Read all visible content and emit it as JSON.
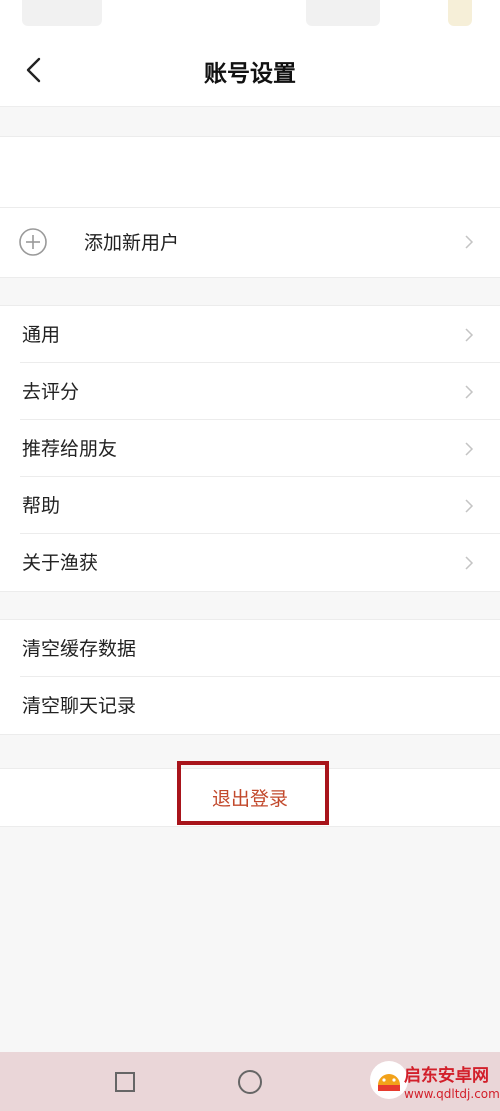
{
  "header": {
    "title": "账号设置",
    "back_icon": "chevron-left-icon"
  },
  "profile_section": {
    "add_user_label": "添加新用户",
    "add_user_icon": "plus-circle-icon"
  },
  "general_section": {
    "items": [
      {
        "label": "通用"
      },
      {
        "label": "去评分"
      },
      {
        "label": "推荐给朋友"
      },
      {
        "label": "帮助"
      },
      {
        "label": "关于渔获"
      }
    ]
  },
  "clear_section": {
    "items": [
      {
        "label": "清空缓存数据"
      },
      {
        "label": "清空聊天记录"
      }
    ]
  },
  "logout": {
    "label": "退出登录",
    "color": "#c2492c",
    "highlight_color": "#a8141b"
  },
  "navbar": {
    "buttons": [
      "square-icon",
      "circle-icon"
    ],
    "background": "#ead6d8"
  },
  "watermark": {
    "title": "启东安卓网",
    "url": "www.qdltdj.com"
  }
}
